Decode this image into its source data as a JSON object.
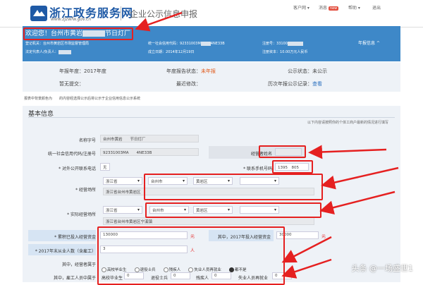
{
  "brand": {
    "title": "浙江政务服务网",
    "url": "www.zjzwfw.gov.cn",
    "system": "企业公示信息申报"
  },
  "top_links": {
    "user": "客户网 ▾",
    "mail": "消息",
    "mail_badge": "new",
    "help": "帮助 ▾",
    "exit": "退出"
  },
  "header": {
    "welcome_prefix": "欢迎您！台州市黄岩",
    "welcome_suffix": "节日灯厂",
    "reg_org_label": "登记机关：",
    "reg_org_value": "台州市黄岩区市场监督管理局",
    "credit_code_label": "统一社会信用代码：",
    "credit_code_value": "92331003M",
    "credit_code_tail": "4NE33B",
    "reg_no_label": "注册号：",
    "reg_no_value": "33100",
    "rep_label": "法定代表人/负责人：",
    "est_date_label": "成立日期：",
    "est_date_value": "2014年12月19日",
    "capital_label": "注册资本：",
    "capital_value": "10.00万元人民币",
    "report_link": "年报信息 ^"
  },
  "summary": {
    "year_label": "年报年度：",
    "year_value": "2017年度",
    "status_label": "年度报告状态：",
    "status_value": "未年报",
    "pub_label": "公示状态：",
    "pub_value": "未公示",
    "submit_label": "暂无提交：",
    "modify_label": "最近修改：",
    "history_label": "历次年报公示记录：",
    "history_link": "查看"
  },
  "notice": "报表中背景颜色为　　的内容经选择公示后将公示于企业信用信息公示系统",
  "section": {
    "title": "基本信息",
    "hint": "以下内容请按照你的个体工商户最新的情况进行填写"
  },
  "form": {
    "name_label": "名称字号",
    "name_value": "台州市黄岩　　节日灯厂",
    "credit_label": "统一社会信用代码/注册号",
    "credit_value": "92331003MA　　4NE33B",
    "operator_label": "经营者姓名",
    "public_phone_label": "* 对外公开联系电话",
    "public_phone_value": "无",
    "phone_label": "* 联系手机号码",
    "phone_value": "1395　805",
    "addr_label": "* 经营场所",
    "addr_province": "浙江省",
    "addr_city": "台州市",
    "addr_district": "黄岩区",
    "addr_full": "浙江省台州市黄岩区　　　",
    "actual_label": "* 实际经营场所",
    "actual_province": "浙江省",
    "actual_city": "台州市",
    "actual_district": "黄岩区",
    "actual_full": "浙江省台州市黄岩区宁溪镇",
    "cumulative_label": "* 累积已投入经营资金",
    "cumulative_value": "130000",
    "cumulative_unit": "元",
    "invest_label": "其中，2017年投入经营资金",
    "invest_value": "30000",
    "invest_unit": "元",
    "employees_label": "* 2017年末从业人数（含雇工）",
    "employees_value": "3",
    "employees_unit": "人",
    "operator_type_label": "其中，经营者属于",
    "operator_options": [
      "高校毕业生",
      "退役士兵",
      "残疾人",
      "失业人员再就业",
      "都不是"
    ],
    "hired_label": "其中，雇工人员中属于",
    "hired_fields": [
      "高校毕业生",
      "退役士兵",
      "残疾人",
      "失业人员再就业"
    ],
    "hired_values": [
      "0",
      "0",
      "0",
      "0"
    ]
  },
  "watermark": "头条 @一场盛世1",
  "colors": {
    "header_blue": "#3e88c8",
    "annotation_red": "#e52020",
    "brand_blue": "#1f5aa6"
  }
}
